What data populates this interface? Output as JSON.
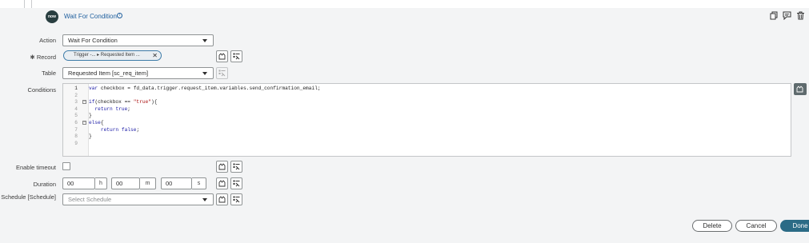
{
  "header": {
    "logo_text": "now",
    "title": "Wait For Condition",
    "info_icon": "info-circle-icon",
    "actions": [
      "copy-icon",
      "comment-icon",
      "trash-icon"
    ]
  },
  "form": {
    "action_label": "Action",
    "action_value": "Wait For Condition",
    "record_label": "Record",
    "record_required_marker": "✱",
    "record_pill_text": "Trigger -...  ▸ Requested Item ...",
    "table_label": "Table",
    "table_value": "Requested Item [sc_req_item]",
    "conditions_label": "Conditions",
    "enable_timeout_label": "Enable timeout",
    "duration_label": "Duration",
    "duration": {
      "hours": "00",
      "hours_unit": "h",
      "minutes": "00",
      "minutes_unit": "m",
      "seconds": "00",
      "seconds_unit": "s"
    },
    "schedule_label": "Schedule [Schedule]",
    "schedule_placeholder": "Select Schedule"
  },
  "code": {
    "lines": [
      {
        "n": "1",
        "fold": "",
        "text": "var checkbox = fd_data.trigger.request_item.variables.send_confirmation_email;"
      },
      {
        "n": "2",
        "fold": "",
        "text": ""
      },
      {
        "n": "3",
        "fold": "−",
        "text": "if(checkbox == \"true\"){"
      },
      {
        "n": "4",
        "fold": "",
        "text": "  return true;"
      },
      {
        "n": "5",
        "fold": "",
        "text": "}"
      },
      {
        "n": "6",
        "fold": "−",
        "text": "else{"
      },
      {
        "n": "7",
        "fold": "",
        "text": "    return false;"
      },
      {
        "n": "8",
        "fold": "",
        "text": "}"
      },
      {
        "n": "9",
        "fold": "",
        "text": ""
      }
    ]
  },
  "footer": {
    "delete_label": "Delete",
    "cancel_label": "Cancel",
    "done_label": "Done"
  },
  "colors": {
    "accent": "#2b6b86",
    "title": "#1f5f9e",
    "pill_border": "#3d7ba8"
  }
}
